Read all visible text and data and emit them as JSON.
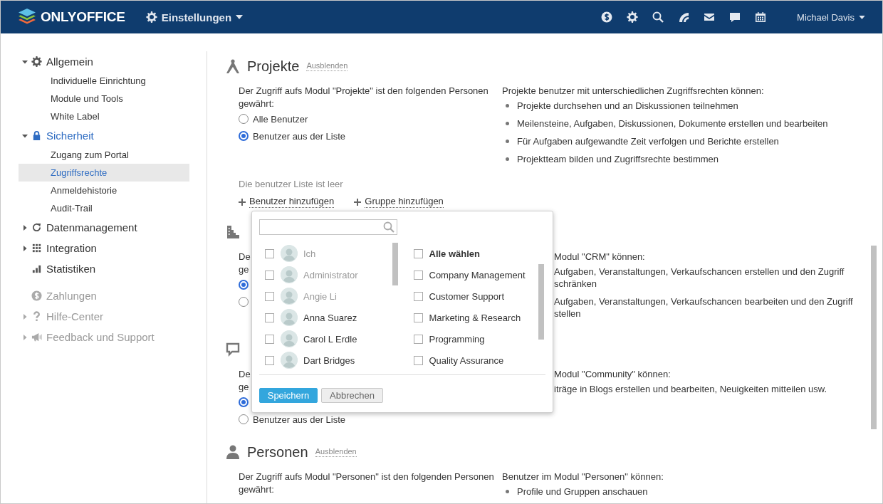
{
  "header": {
    "logo_text": "ONLYOFFICE",
    "module_title": "Einstellungen",
    "user_name": "Michael Davis"
  },
  "sidebar": {
    "groups": [
      {
        "items": [
          {
            "label": "Allgemein",
            "kind": "folder",
            "expanded": true,
            "selected": false,
            "disabled": false,
            "children": [
              {
                "label": "Individuelle Einrichtung",
                "selected": false
              },
              {
                "label": "Module und Tools",
                "selected": false
              },
              {
                "label": "White Label",
                "selected": false
              }
            ]
          },
          {
            "label": "Sicherheit",
            "kind": "folder",
            "expanded": true,
            "selected": true,
            "disabled": false,
            "children": [
              {
                "label": "Zugang zum Portal",
                "selected": false
              },
              {
                "label": "Zugriffsrechte",
                "selected": true
              },
              {
                "label": "Anmeldehistorie",
                "selected": false
              },
              {
                "label": "Audit-Trail",
                "selected": false
              }
            ]
          },
          {
            "label": "Datenmanagement",
            "kind": "folder",
            "expanded": false,
            "selected": false,
            "disabled": false
          },
          {
            "label": "Integration",
            "kind": "folder",
            "expanded": false,
            "selected": false,
            "disabled": false
          },
          {
            "label": "Statistiken",
            "kind": "link",
            "selected": false,
            "disabled": false
          }
        ]
      },
      {
        "items": [
          {
            "label": "Zahlungen",
            "kind": "link",
            "selected": false,
            "disabled": true
          },
          {
            "label": "Hilfe-Center",
            "kind": "folder",
            "expanded": false,
            "selected": false,
            "disabled": true
          },
          {
            "label": "Feedback und Support",
            "kind": "folder",
            "expanded": false,
            "selected": false,
            "disabled": true
          }
        ]
      }
    ]
  },
  "sections": [
    {
      "kind": "full",
      "title": "Projekte",
      "hide_link": "Ausblenden",
      "description": "Der Zugriff aufs Modul \"Projekte\" ist den folgenden Personen gewährt:",
      "radios": [
        {
          "label": "Alle Benutzer",
          "selected": false
        },
        {
          "label": "Benutzer aus der Liste",
          "selected": true
        }
      ],
      "rights_intro": "Projekte benutzer mit unterschiedlichen Zugriffsrechten können:",
      "rights": [
        "Projekte durchsehen und an Diskussionen teilnehmen",
        "Meilensteine, Aufgaben, Diskussionen, Dokumente erstellen und bearbeiten",
        "Für Aufgaben aufgewandte Zeit verfolgen und Berichte erstellen",
        "Projektteam bilden und Zugriffsrechte bestimmen"
      ],
      "empty_note": "Die benutzer Liste ist leer",
      "add_links": [
        "Benutzer hinzufügen",
        "Gruppe hinzufügen"
      ]
    },
    {
      "kind": "covered",
      "description": "De\nge",
      "radios": [
        {
          "selected": true
        },
        {
          "selected": false
        }
      ],
      "rights_intro": "Modul \"CRM\" können:",
      "rights": [
        "Aufgaben, Veranstaltungen, Verkaufschancen erstellen und den Zugriff\nschränken",
        "Aufgaben, Veranstaltungen, Verkaufschancen bearbeiten und den Zugriff\nstellen"
      ]
    },
    {
      "kind": "covered",
      "description": "De\nge",
      "radios": [
        {
          "selected": true
        },
        {
          "label": "Benutzer aus der Liste",
          "selected": false
        }
      ],
      "rights_intro": "Modul \"Community\" können:",
      "rights": [
        "iträge in Blogs erstellen und bearbeiten, Neuigkeiten mitteilen usw."
      ]
    },
    {
      "kind": "full",
      "title": "Personen",
      "hide_link": "Ausblenden",
      "description": "Der Zugriff aufs Modul \"Personen\" ist den folgenden Personen gewährt:",
      "rights_intro": "Benutzer im Modul \"Personen\" können:",
      "rights": [
        "Profile und Gruppen anschauen"
      ]
    }
  ],
  "user_picker": {
    "users": [
      {
        "name": "Ich",
        "checked": false,
        "disabled": true
      },
      {
        "name": "Administrator",
        "checked": false,
        "disabled": true
      },
      {
        "name": "Angie Li",
        "checked": false,
        "disabled": true
      },
      {
        "name": "Anna Suarez",
        "checked": false,
        "disabled": false
      },
      {
        "name": "Carol L Erdle",
        "checked": false,
        "disabled": false
      },
      {
        "name": "Dart Bridges",
        "checked": false,
        "disabled": false
      }
    ],
    "groups": [
      {
        "kind": "all",
        "label": "Alle wählen",
        "checked": false
      },
      {
        "kind": "group",
        "label": "Company Management",
        "checked": false
      },
      {
        "kind": "group",
        "label": "Customer Support",
        "checked": false
      },
      {
        "kind": "group",
        "label": "Marketing & Research",
        "checked": false
      },
      {
        "kind": "group",
        "label": "Programming",
        "checked": false
      },
      {
        "kind": "group",
        "label": "Quality Assurance",
        "checked": false
      }
    ],
    "save_label": "Speichern",
    "cancel_label": "Abbrechen"
  }
}
